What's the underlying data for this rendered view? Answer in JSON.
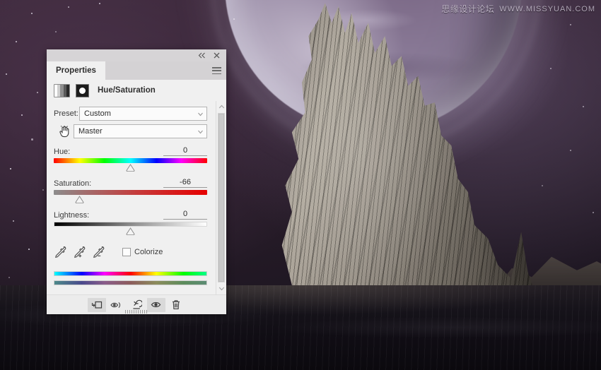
{
  "watermark": {
    "cn": "思缘设计论坛",
    "en": "WWW.MISSYUAN.COM"
  },
  "panel": {
    "topbar": {
      "collapse_icon": "double-chevron-left-icon",
      "close_icon": "close-icon"
    },
    "tab": {
      "label": "Properties",
      "menu_icon": "panel-menu-icon"
    },
    "adjustment": {
      "layer_icon": "hue-saturation-adjustment-icon",
      "mask_icon": "layer-mask-thumbnail",
      "title": "Hue/Saturation"
    },
    "preset": {
      "label": "Preset:",
      "value": "Custom",
      "caret_icon": "chevron-down-icon"
    },
    "channel": {
      "tool_icon": "on-image-adjustment-hand-icon",
      "value": "Master",
      "caret_icon": "chevron-down-icon"
    },
    "sliders": [
      {
        "name": "Hue:",
        "value": "0",
        "thumb_pct": 50,
        "track": "hue"
      },
      {
        "name": "Saturation:",
        "value": "-66",
        "thumb_pct": 17,
        "track": "sat"
      },
      {
        "name": "Lightness:",
        "value": "0",
        "thumb_pct": 50,
        "track": "light"
      }
    ],
    "droppers": [
      {
        "icon": "eyedropper-icon",
        "name": "sample-color"
      },
      {
        "icon": "eyedropper-plus-icon",
        "name": "add-to-sample"
      },
      {
        "icon": "eyedropper-minus-icon",
        "name": "subtract-from-sample"
      }
    ],
    "colorize": {
      "label": "Colorize",
      "checked": false
    },
    "footer": [
      {
        "name": "clip-to-layer-button",
        "icon": "clip-to-layer-icon",
        "active": true
      },
      {
        "name": "toggle-previous-button",
        "icon": "eye-previous-icon",
        "active": false
      },
      {
        "name": "reset-button",
        "icon": "reset-arrow-icon",
        "active": false
      },
      {
        "name": "toggle-visibility-button",
        "icon": "eye-icon",
        "active": true
      },
      {
        "name": "delete-button",
        "icon": "trash-icon",
        "active": false
      }
    ],
    "scrollbar": {
      "up_icon": "chevron-up-icon",
      "down_icon": "chevron-down-icon"
    }
  }
}
